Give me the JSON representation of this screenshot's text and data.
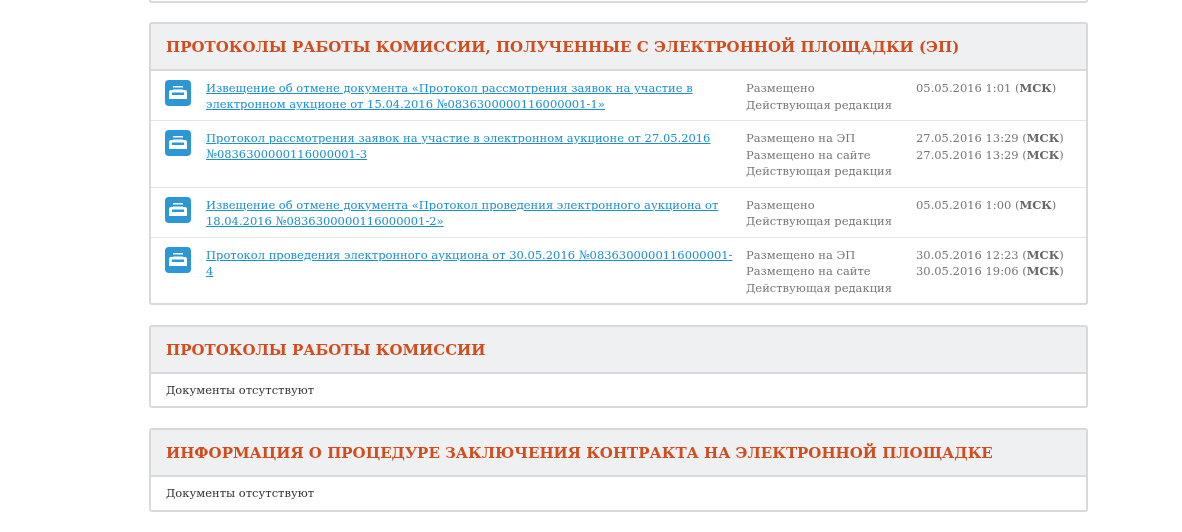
{
  "sections": [
    {
      "title": "ПРОТОКОЛЫ РАБОТЫ КОМИССИИ, ПОЛУЧЕННЫЕ С ЭЛЕКТРОННОЙ ПЛОЩАДКИ (ЭП)",
      "documents": [
        {
          "title": "Извещение об отмене документа «Протокол рассмотрения заявок на участие в электронном аукционе от 15.04.2016 №0836300000116000001-1»",
          "lines": [
            {
              "label": "Размещено",
              "date": "05.05.2016 1:01 (**МСК**)"
            },
            {
              "label": "Действующая редакция"
            }
          ]
        },
        {
          "title": "Протокол рассмотрения заявок на участие в электронном аукционе от 27.05.2016 №0836300000116000001-3",
          "lines": [
            {
              "label": "Размещено на ЭП",
              "date": "27.05.2016 13:29 (**МСК**)"
            },
            {
              "label": "Размещено на сайте",
              "date": "27.05.2016 13:29 (**МСК**)"
            },
            {
              "label": "Действующая редакция"
            }
          ]
        },
        {
          "title": "Извещение об отмене документа «Протокол проведения электронного аукциона от 18.04.2016 №0836300000116000001-2»",
          "lines": [
            {
              "label": "Размещено",
              "date": "05.05.2016 1:00 (**МСК**)"
            },
            {
              "label": "Действующая редакция"
            }
          ]
        },
        {
          "title": "Протокол проведения электронного аукциона от 30.05.2016 №0836300000116000001-4",
          "lines": [
            {
              "label": "Размещено на ЭП",
              "date": "30.05.2016 12:23 (**МСК**)"
            },
            {
              "label": "Размещено на сайте",
              "date": "30.05.2016 19:06 (**МСК**)"
            },
            {
              "label": "Действующая редакция"
            }
          ]
        }
      ]
    },
    {
      "title": "ПРОТОКОЛЫ РАБОТЫ КОМИССИИ",
      "empty_text": "Документы отсутствуют"
    },
    {
      "title": "ИНФОРМАЦИЯ О ПРОЦЕДУРЕ ЗАКЛЮЧЕНИЯ КОНТРАКТА НА ЭЛЕКТРОННОЙ ПЛОЩАДКЕ",
      "empty_text": "Документы отсутствуют"
    }
  ]
}
